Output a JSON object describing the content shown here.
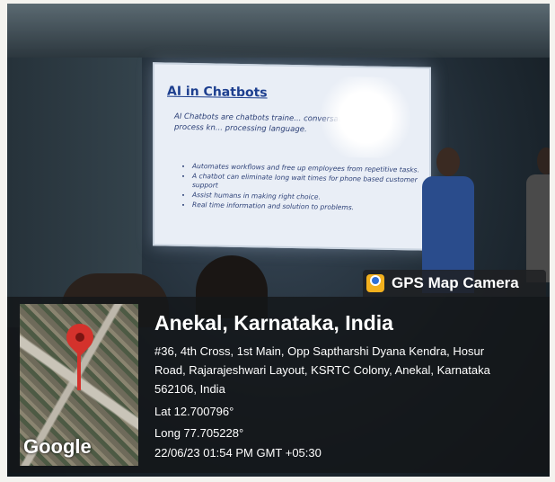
{
  "slide": {
    "title": "AI in Chatbots",
    "intro": "AI Chatbots are chatbots traine... conversations using a process kn... processing language.",
    "bullets": [
      "Automates workflows and free up employees from repetitive tasks.",
      "A chatbot can eliminate long wait times for phone based customer support",
      "Assist humans in making right choice.",
      "Real time information and solution to problems."
    ]
  },
  "badge": {
    "icon": "gps-map-camera-icon",
    "label": "GPS Map Camera"
  },
  "map": {
    "brand": "Google",
    "pin_icon": "location-pin-icon",
    "pin_color": "#d4322c"
  },
  "location": {
    "place": "Anekal, Karnataka, India",
    "address_lines": [
      "#36, 4th Cross, 1st Main, Opp Saptharshi Dyana Kendra, Hosur",
      "Road, Rajarajeshwari Layout, KSRTC Colony, Anekal, Karnataka",
      "562106, India"
    ],
    "lat": "Lat 12.700796°",
    "long": "Long 77.705228°",
    "datetime": "22/06/23 01:54 PM GMT +05:30"
  }
}
